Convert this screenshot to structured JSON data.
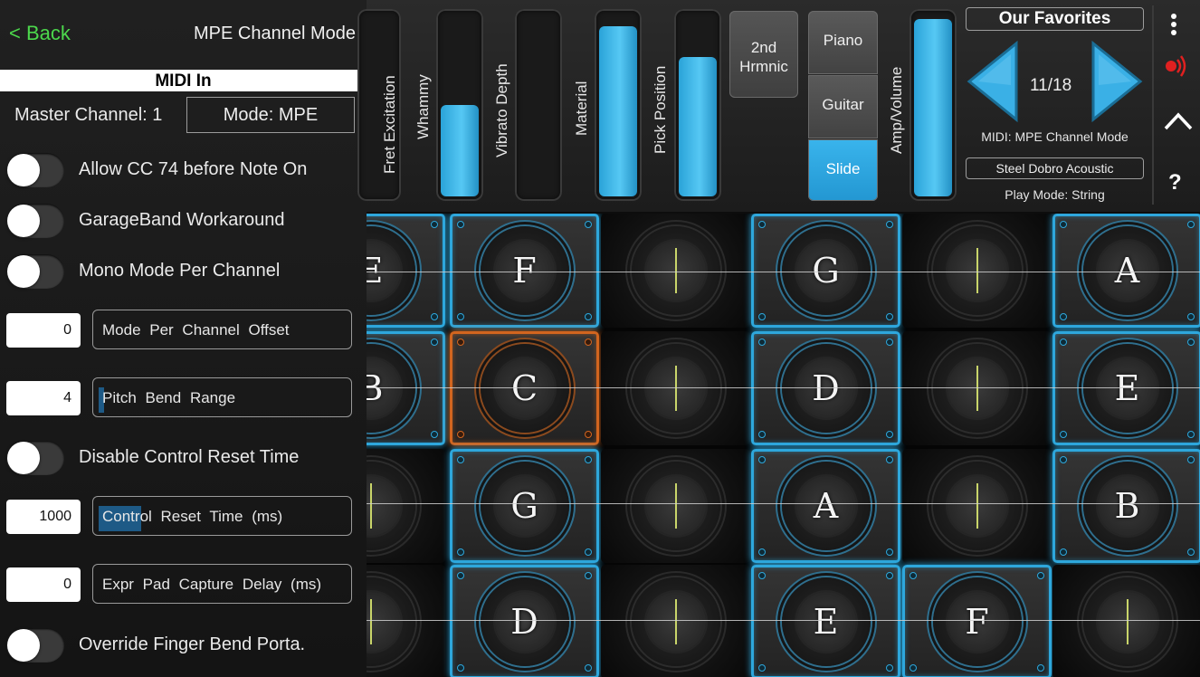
{
  "panel": {
    "back_label": "< Back",
    "title": "MPE Channel Mode",
    "section": "MIDI In",
    "master_channel": "Master Channel: 1",
    "mode_button": "Mode: MPE",
    "toggles": [
      {
        "label": "Allow CC 74 before Note On",
        "on": false
      },
      {
        "label": "GarageBand Workaround",
        "on": false
      },
      {
        "label": "Mono Mode Per Channel",
        "on": false
      },
      {
        "label": "Disable Control Reset Time",
        "on": false
      },
      {
        "label": "Override Finger Bend Porta.",
        "on": false
      }
    ],
    "params": [
      {
        "value": "0",
        "label": "Mode  Per  Channel  Offset",
        "level": 0
      },
      {
        "value": "4",
        "label": "Pitch  Bend  Range",
        "level": 0.02
      },
      {
        "value": "1000",
        "label": "Control  Reset  Time (ms)",
        "level": 0.17
      },
      {
        "value": "0",
        "label": "Expr  Pad  Capture  Delay (ms)",
        "level": 0
      }
    ]
  },
  "controls": {
    "sliders": [
      {
        "label": "Fret Excitation",
        "level": 0
      },
      {
        "label": "Whammy",
        "level": 0.5
      },
      {
        "label": "Vibrato Depth",
        "level": 0
      },
      {
        "label": "Material",
        "level": 0.93
      },
      {
        "label": "Pick Position",
        "level": 0.76
      },
      {
        "label": "Amp/Volume",
        "level": 0.97
      }
    ],
    "harmonic_button": "2nd\nHrmnic",
    "instrument_segments": [
      {
        "label": "Piano",
        "selected": false
      },
      {
        "label": "Guitar",
        "selected": false
      },
      {
        "label": "Slide",
        "selected": true
      }
    ],
    "favorites_title": "Our Favorites",
    "preset_counter": "11/18",
    "midi_status": "MIDI: MPE Channel Mode",
    "preset_name": "Steel Dobro Acoustic",
    "play_mode": "Play Mode: String",
    "accent_color": "#2ea7dc",
    "highlight_color": "#d2651f"
  },
  "side_icons": [
    "more-vertical-icon",
    "midi-activity-icon",
    "chevron-up-icon",
    "help-icon"
  ],
  "side_icon_glyphs": {
    "help": "?"
  },
  "grid": {
    "rows": [
      [
        {
          "note": "E",
          "state": "lit"
        },
        {
          "note": "F",
          "state": "lit"
        },
        {
          "note": "",
          "state": "dark"
        },
        {
          "note": "G",
          "state": "lit"
        },
        {
          "note": "",
          "state": "dark"
        },
        {
          "note": "A",
          "state": "lit"
        }
      ],
      [
        {
          "note": "B",
          "state": "lit"
        },
        {
          "note": "C",
          "state": "hit"
        },
        {
          "note": "",
          "state": "dark"
        },
        {
          "note": "D",
          "state": "lit"
        },
        {
          "note": "",
          "state": "dark"
        },
        {
          "note": "E",
          "state": "lit"
        }
      ],
      [
        {
          "note": "",
          "state": "dark"
        },
        {
          "note": "G",
          "state": "lit"
        },
        {
          "note": "",
          "state": "dark"
        },
        {
          "note": "A",
          "state": "lit"
        },
        {
          "note": "",
          "state": "dark"
        },
        {
          "note": "B",
          "state": "lit"
        }
      ],
      [
        {
          "note": "",
          "state": "dark"
        },
        {
          "note": "D",
          "state": "lit"
        },
        {
          "note": "",
          "state": "dark"
        },
        {
          "note": "E",
          "state": "lit"
        },
        {
          "note": "F",
          "state": "lit"
        },
        {
          "note": "",
          "state": "dark"
        }
      ]
    ]
  }
}
